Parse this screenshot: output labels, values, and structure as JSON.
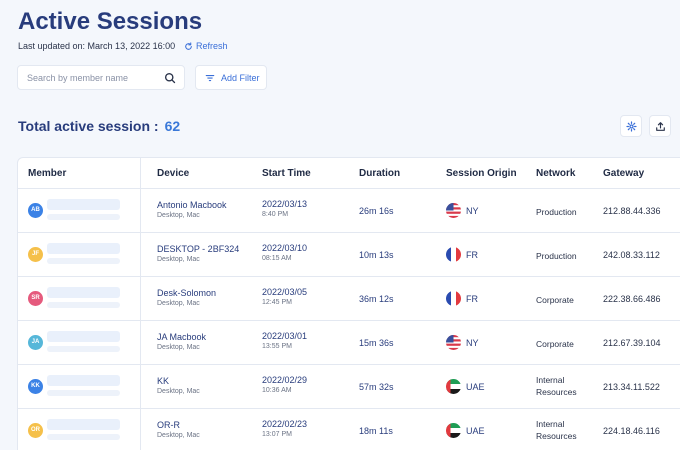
{
  "header": {
    "title": "Active Sessions",
    "last_updated": "Last updated on: March 13, 2022 16:00",
    "refresh_label": "Refresh"
  },
  "toolbar": {
    "search_placeholder": "Search by member name",
    "filter_label": "Add Filter"
  },
  "summary": {
    "label": "Total active session :",
    "count": "62"
  },
  "table": {
    "columns": [
      "Member",
      "Device",
      "Start Time",
      "Duration",
      "Session Origin",
      "Network",
      "Gateway"
    ],
    "rows": [
      {
        "initials": "AB",
        "avatar_color": "#3b82e6",
        "device": "Antonio Macbook",
        "device_sub": "Desktop, Mac",
        "date": "2022/03/13",
        "time": "8:40 PM",
        "duration": "26m 16s",
        "flag": "us",
        "origin": "NY",
        "network": "Production",
        "gateway": "212.88.44.336"
      },
      {
        "initials": "JF",
        "avatar_color": "#f5c04a",
        "device": "DESKTOP - 2BF324",
        "device_sub": "Desktop, Mac",
        "date": "2022/03/10",
        "time": "08:15 AM",
        "duration": "10m 13s",
        "flag": "fr",
        "origin": "FR",
        "network": "Production",
        "gateway": "242.08.33.112"
      },
      {
        "initials": "SR",
        "avatar_color": "#e55a7d",
        "device": "Desk-Solomon",
        "device_sub": "Desktop, Mac",
        "date": "2022/03/05",
        "time": "12:45 PM",
        "duration": "36m 12s",
        "flag": "fr",
        "origin": "FR",
        "network": "Corporate",
        "gateway": "222.38.66.486"
      },
      {
        "initials": "JA",
        "avatar_color": "#56b7d9",
        "device": "JA Macbook",
        "device_sub": "Desktop, Mac",
        "date": "2022/03/01",
        "time": "13:55 PM",
        "duration": "15m 36s",
        "flag": "us",
        "origin": "NY",
        "network": "Corporate",
        "gateway": "212.67.39.104"
      },
      {
        "initials": "KK",
        "avatar_color": "#3b82e6",
        "device": "KK",
        "device_sub": "Desktop, Mac",
        "date": "2022/02/29",
        "time": "10:36 AM",
        "duration": "57m 32s",
        "flag": "ae",
        "origin": "UAE",
        "network_line1": "Internal",
        "network_line2": "Resources",
        "gateway": "213.34.11.522"
      },
      {
        "initials": "OR",
        "avatar_color": "#f5c04a",
        "device": "OR-R",
        "device_sub": "Desktop, Mac",
        "date": "2022/02/23",
        "time": "13:07 PM",
        "duration": "18m 11s",
        "flag": "ae",
        "origin": "UAE",
        "network_line1": "Internal",
        "network_line2": "Resources",
        "gateway": "224.18.46.116"
      }
    ]
  },
  "icons": {
    "refresh": "refresh-icon",
    "search": "search-icon",
    "filter": "filter-icon",
    "settings": "gear-icon",
    "export": "upload-icon"
  }
}
